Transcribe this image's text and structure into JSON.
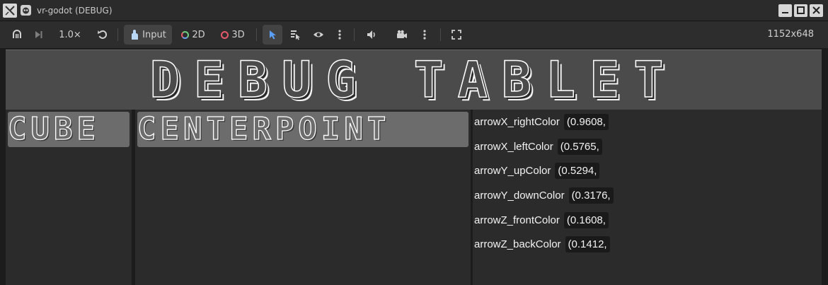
{
  "window": {
    "title": "vr-godot (DEBUG)",
    "icons": [
      "app-x-icon",
      "godot-icon",
      "minimize-icon",
      "maximize-icon",
      "close-icon"
    ]
  },
  "toolbar": {
    "speed_label": "1.0×",
    "input_label": "Input",
    "mode_2d_label": "2D",
    "mode_3d_label": "3D",
    "resolution": "1152x648",
    "icons": [
      "suspend-icon",
      "next-frame-icon",
      "reset-speed-icon",
      "input-hand-icon",
      "select-arrow-icon",
      "list-select-icon",
      "visibility-eye-icon",
      "more-vert-icon",
      "speaker-icon",
      "camera-icon",
      "more-vert-icon",
      "fullscreen-icon"
    ]
  },
  "banner": {
    "title": "DEBUG TABLET"
  },
  "columns": {
    "cube": {
      "header": "CUBE"
    },
    "centerpoint": {
      "header": "CENTERPOINT"
    }
  },
  "properties": [
    {
      "label": "arrowX_rightColor",
      "value": "(0.9608,"
    },
    {
      "label": "arrowX_leftColor",
      "value": "(0.5765,"
    },
    {
      "label": "arrowY_upColor",
      "value": "(0.5294,"
    },
    {
      "label": "arrowY_downColor",
      "value": "(0.3176,"
    },
    {
      "label": "arrowZ_frontColor",
      "value": "(0.1608,"
    },
    {
      "label": "arrowZ_backColor",
      "value": "(0.1412,"
    }
  ],
  "colors": {
    "background": "#1c1c1c",
    "banner": "#4b4b4b",
    "header": "#6c6c6c",
    "accent_select": "#5a9ef5"
  }
}
